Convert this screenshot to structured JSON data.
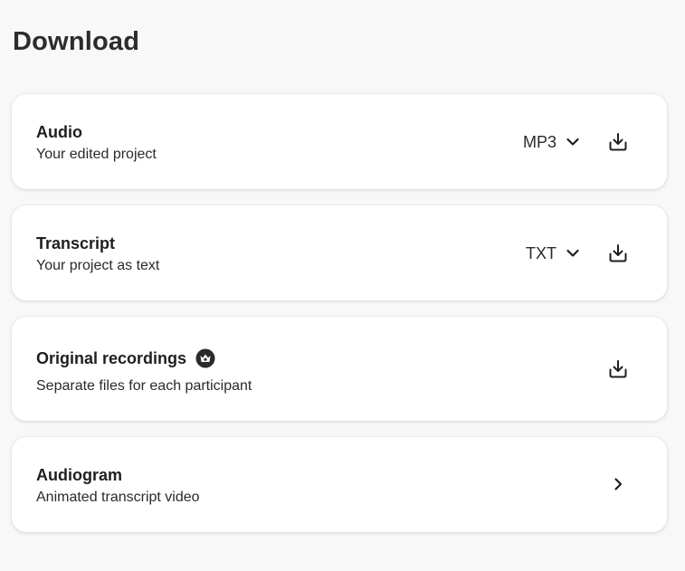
{
  "page": {
    "title": "Download"
  },
  "cards": [
    {
      "title": "Audio",
      "subtitle": "Your edited project",
      "format": "MP3",
      "action_icon": "download-icon"
    },
    {
      "title": "Transcript",
      "subtitle": "Your project as text",
      "format": "TXT",
      "action_icon": "download-icon"
    },
    {
      "title": "Original recordings",
      "subtitle": "Separate files for each participant",
      "badge_icon": "premium-crown-icon",
      "action_icon": "download-icon"
    },
    {
      "title": "Audiogram",
      "subtitle": "Animated transcript video",
      "action_icon": "chevron-right-icon"
    }
  ],
  "colors": {
    "background": "#f8f8f8",
    "card": "#ffffff",
    "text": "#222222"
  }
}
